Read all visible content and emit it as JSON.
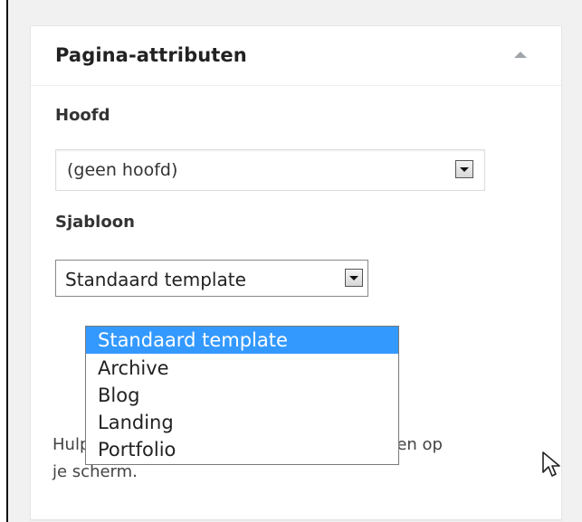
{
  "metabox": {
    "title": "Pagina-attributen",
    "toggle_icon": "arrow-up-icon"
  },
  "parent": {
    "label": "Hoofd",
    "selected": "(geen hoofd)"
  },
  "template": {
    "label": "Sjabloon",
    "selected": "Standaard template",
    "options": [
      "Standaard template",
      "Archive",
      "Blog",
      "Landing",
      "Portfolio"
    ]
  },
  "help": {
    "text": "Hulp nodig? Gebruik de helptab rechtsboven op je scherm."
  },
  "colors": {
    "highlight": "#3399ff",
    "page_bg": "#f1f1f1"
  }
}
